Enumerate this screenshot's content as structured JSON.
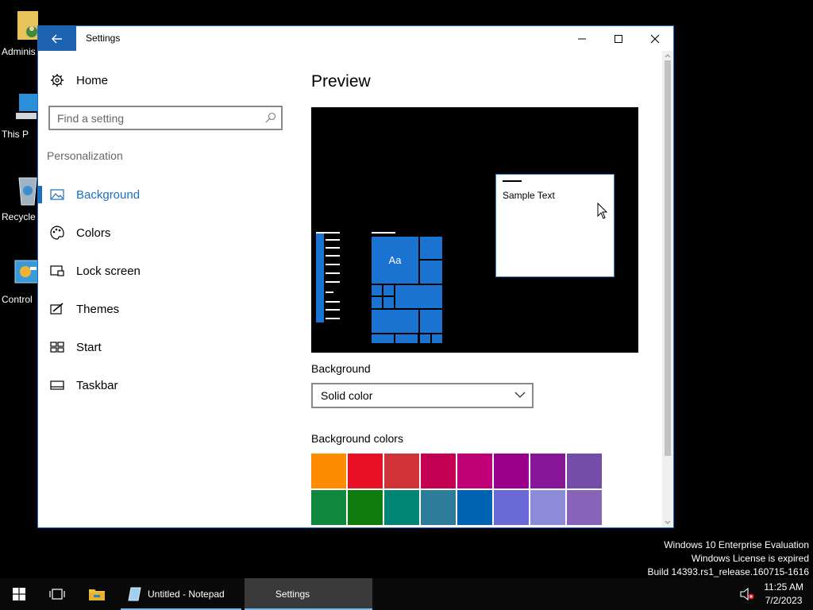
{
  "desktop": {
    "icons": [
      {
        "label": "Adminis",
        "icon": "user-folder-icon"
      },
      {
        "label": "This P",
        "icon": "this-pc-icon"
      },
      {
        "label": "Recycle",
        "icon": "recycle-bin-icon"
      },
      {
        "label": "Control",
        "icon": "control-panel-icon"
      }
    ]
  },
  "window": {
    "title": "Settings",
    "back_icon": "back-arrow-icon",
    "controls": {
      "minimize": "minimize-icon",
      "maximize": "maximize-icon",
      "close": "close-icon"
    }
  },
  "sidebar": {
    "home_label": "Home",
    "search_placeholder": "Find a setting",
    "section_label": "Personalization",
    "items": [
      {
        "label": "Background",
        "icon": "picture-icon",
        "active": true
      },
      {
        "label": "Colors",
        "icon": "palette-icon",
        "active": false
      },
      {
        "label": "Lock screen",
        "icon": "lock-screen-icon",
        "active": false
      },
      {
        "label": "Themes",
        "icon": "themes-icon",
        "active": false
      },
      {
        "label": "Start",
        "icon": "start-icon",
        "active": false
      },
      {
        "label": "Taskbar",
        "icon": "taskbar-icon",
        "active": false
      }
    ]
  },
  "main": {
    "preview_title": "Preview",
    "preview": {
      "tile_text": "Aa",
      "sample_text": "Sample Text"
    },
    "background_label": "Background",
    "background_value": "Solid color",
    "colors_label": "Background colors",
    "colors": [
      "#ff8c00",
      "#e81123",
      "#d13438",
      "#c30052",
      "#bf0077",
      "#9a0089",
      "#881798",
      "#744da9",
      "#10893e",
      "#107c10",
      "#018574",
      "#2d7d9a",
      "#0063b1",
      "#6b69d6",
      "#8e8cd8",
      "#8764b8"
    ]
  },
  "watermark": {
    "line1": "Windows 10 Enterprise Evaluation",
    "line2": "Windows License is expired",
    "line3": "Build 14393.rs1_release.160715-1616"
  },
  "taskbar": {
    "apps": [
      {
        "label": "Untitled - Notepad",
        "icon": "notepad-icon"
      },
      {
        "label": "Settings"
      }
    ],
    "time": "11:25 AM",
    "date": "7/2/2023"
  },
  "theme": {
    "accent": "#1a6fbf"
  }
}
